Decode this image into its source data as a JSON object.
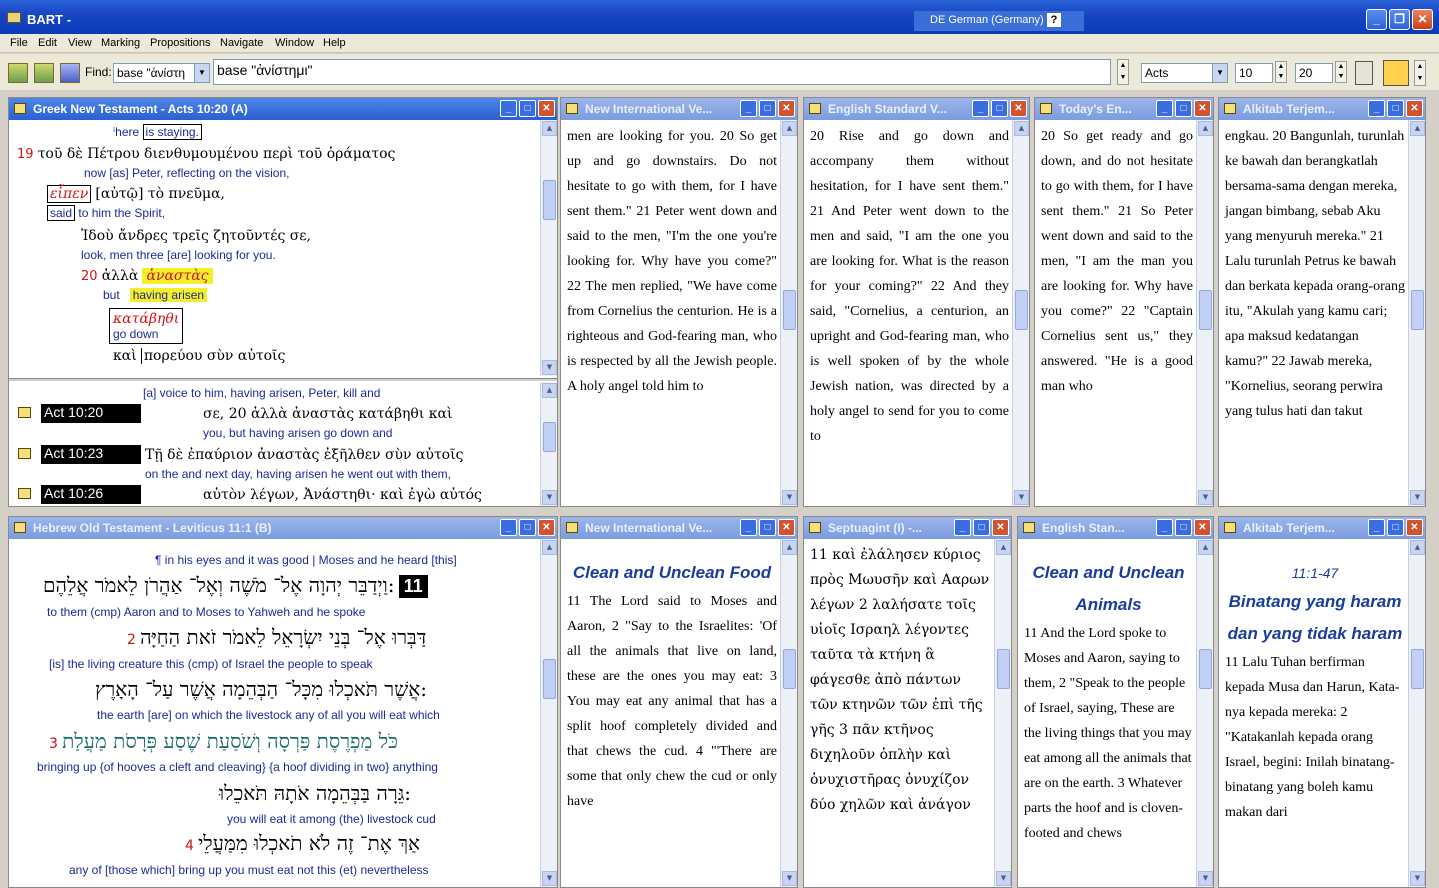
{
  "app": {
    "title": "BART -",
    "language": "DE German (Germany)"
  },
  "menu": [
    "File",
    "Edit",
    "View",
    "Marking",
    "Propositions",
    "Navigate",
    "Window",
    "Help"
  ],
  "toolbar": {
    "find_label": "Find:",
    "find_combo": "base \"ἀνίστη",
    "find_value": "base \"ἀνίστημι\"",
    "book": "Acts",
    "chapter": "10",
    "verse": "20"
  },
  "panes": {
    "greek_nt": {
      "title": "Greek New Testament - Acts 10:20 (A)"
    },
    "niv_top": {
      "title": "New International Ve..."
    },
    "esv_top": {
      "title": "English Standard V..."
    },
    "tev_top": {
      "title": "Today's En..."
    },
    "alkitab_top": {
      "title": "Alkitab Terjem..."
    },
    "hebrew_ot": {
      "title": "Hebrew Old Testament - Leviticus 11:1 (B)"
    },
    "niv_bot": {
      "title": "New International Ve..."
    },
    "lxx": {
      "title": "Septuagint (I) -..."
    },
    "esv_bot": {
      "title": "English Stan..."
    },
    "alkitab_bot": {
      "title": "Alkitab Terjem..."
    }
  },
  "refs": [
    "Act 10:20",
    "Act 10:23",
    "Act 10:26"
  ],
  "texts": {
    "niv_top": "men are looking for you. 20 So get up and go downstairs. Do not hesitate to go with them, for I have sent them.\" 21 Peter went down and said to the men, \"I'm the one you're looking for. Why have you come?\" 22 The men replied, \"We have come from Cornelius the centurion. He is a righteous and God-fearing man, who is respected by all the Jewish people. A holy angel told him to",
    "esv_top": "20 Rise and go down and accompany them without hesitation, for I have sent them.\" 21 And Peter went down to the men and said, \"I am the one you are looking for. What is the reason for your coming?\" 22 And they said, \"Cornelius, a centurion, an upright and God-fearing man, who is well spoken of by the whole Jewish nation, was directed by a holy angel to send for you to come to",
    "tev_top": "20 So get ready and go down, and do not hesitate to go with them, for I have sent them.\" 21 So Peter went down and said to the men, \"I am the man you are looking for. Why have you come?\" 22 \"Captain Cornelius sent us,\" they answered. \"He is a good man who",
    "alkitab_top": "engkau. 20 Bangunlah, turunlah ke bawah dan berangkatlah bersama-sama dengan mereka, jangan bimbang, sebab Aku yang menyuruh mereka.\" 21 Lalu turunlah Petrus ke bawah dan berkata kepada orang-orang itu, \"Akulah yang kamu cari; apa maksud kedatangan kamu?\" 22 Jawab mereka, \"Kornelius, seorang perwira yang tulus hati dan takut",
    "niv_bot_heading": "Clean and Unclean Food",
    "niv_bot": "11 The Lord said to Moses and Aaron, 2 \"Say to the Israelites: 'Of all the animals that live on land, these are the ones you may eat: 3 You may eat any animal that has a split hoof completely divided and that chews the cud. 4 \"'There are some that only chew the cud or only have",
    "lxx": "11 καὶ ἐλάλησεν κύριος πρὸς Μωυσῆν καὶ Ααρων λέγων 2 λαλήσατε τοῖς υἱοῖς Ισραηλ λέγοντες ταῦτα τὰ κτήνη ἃ φάγεσθε ἀπὸ πάντων τῶν κτηνῶν τῶν ἐπὶ τῆς γῆς 3 πᾶν κτῆνος διχηλοῦν ὁπλὴν καὶ ὀνυχιστῆρας ὀνυχίζον δύο χηλῶν καὶ ἀνάγον",
    "esv_bot_heading": "Clean and Unclean Animals",
    "esv_bot": "11 And the Lord spoke to Moses and Aaron, saying to them, 2 \"Speak to the people of Israel, saying, These are the living things that you may eat among all the animals that are on the earth. 3 Whatever parts the hoof and is cloven-footed and chews",
    "alkitab_bot_ref": "11:1-47",
    "alkitab_bot_heading": "Binatang yang haram dan yang tidak haram",
    "alkitab_bot": "11 Lalu Tuhan berfirman kepada Musa dan Harun, Kata-nya kepada mereka: 2 \"Katakanlah kepada orang Israel, begini: Inilah binatang-binatang yang boleh kamu makan dari"
  },
  "greek": {
    "line1_gloss_a": "here",
    "line1_gloss_b": "is staying.",
    "v19": "19",
    "v19_greek": "τοῦ δὲ Πέτρου διενθυμουμένου περὶ τοῦ ὁράματος",
    "v19_gloss": "now [as] Peter, reflecting on the vision,",
    "eipen": "εἶπεν",
    "eipen_rest": "[αὐτῷ] τὸ πνεῦμα,",
    "said": "said",
    "said_rest": "to him the Spirit,",
    "idou": "Ἰδοὺ ἄνδρες τρεῖς ζητοῦντές σε,",
    "idou_gloss": "look, men three [are] looking for you.",
    "v20": "20",
    "alla": "ἀλλὰ",
    "anastas": "ἀναστὰς",
    "but": "but",
    "having_arisen": "having arisen",
    "katabethi": "κατάβηθι",
    "go_down": "go down",
    "kai": "καὶ",
    "poreuou": "πορεύου σὺν αὐτοῖς"
  },
  "refrows": {
    "row0_gloss": "[a] voice to him, having arisen, Peter, kill and",
    "r1_greek": "σε, 20 ἀλλὰ ἀναστὰς κατάβηθι καὶ",
    "r1_gloss": "you, but having arisen go down and",
    "r2_greek": "Τῇ δὲ ἐπαύριον ἀναστὰς ἐξῆλθεν σὺν αὐτοῖς",
    "r2_gloss": "on the and next day, having arisen he went out with them,",
    "r3_greek": "αὐτὸν λέγων, Ἀνάστηθι· καὶ ἐγὼ αὐτός"
  },
  "hebrew": {
    "l0_gloss": "¶ in his eyes and it was good | Moses and he heard [this]",
    "l1_heb": "וַיְדַבֵּר יְהוָה אֶל־ מֹשֶׁה וְאֶל־ אַהֲרֹן לֵאמֹר אֲלֵהֶם:",
    "l1_gloss": "to them (cmp) Aaron and to Moses to Yahweh and he spoke",
    "v11": "11",
    "l2_heb": "דַּבְּרוּ אֶל־ בְּנֵי יִשְׂרָאֵל לֵאמֹר זֹאת הַחַיָּה",
    "v2": "2",
    "l2_gloss": "[is] the living creature this (cmp) of Israel the people to speak",
    "l3_heb": "אֲשֶׁר תֹּאכְלוּ מִכָּל־ הַבְּהֵמָה אֲשֶׁר עַל־ הָאָרֶץ:",
    "l3_gloss": "the earth [are] on which the livestock any of all you will eat which",
    "l4_heb": "כֹּל מַפְרֶסֶת פַּרְסָה וְשֹׁסַעַת שֶׁסַע פְּרָסֹת מַעֲלַת",
    "v3": "3",
    "l4_gloss": "bringing up {of hooves a cleft and cleaving} {a hoof dividing in two} anything",
    "l5_heb": "גֵּרָה בַּבְּהֵמָה אֹתָהּ תֹּאכֵלוּ:",
    "l5_gloss": "you will eat it among (the) livestock cud",
    "l6_heb": "אַךְ אֶת־ זֶה לֹא תֹאכְלוּ מִמַּעֲלֵי",
    "v4": "4",
    "l6_gloss": "any of [those which] bring up you must eat not this (et) nevertheless"
  }
}
